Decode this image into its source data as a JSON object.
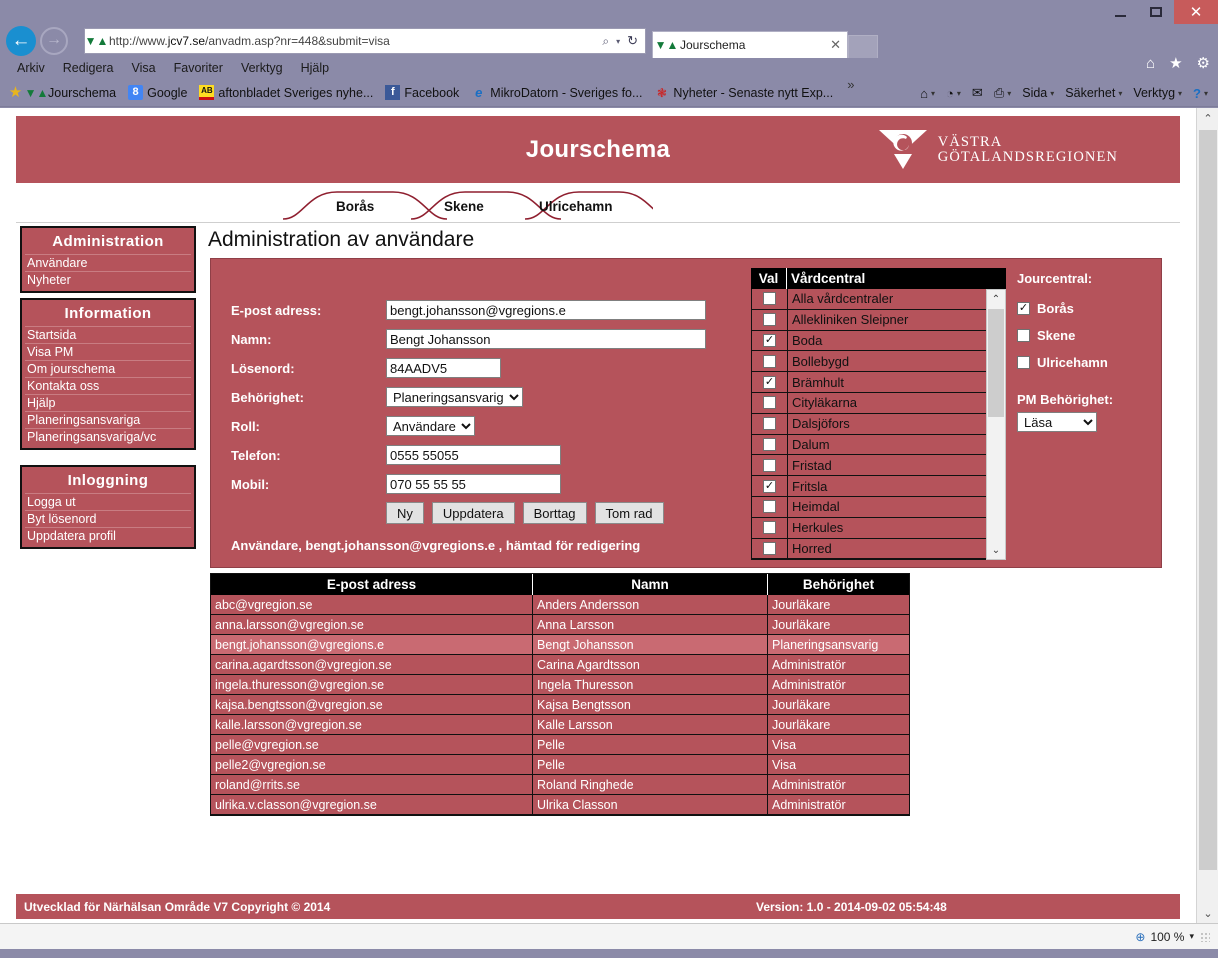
{
  "browser": {
    "window_controls": {
      "minimize": "—",
      "maximize": "▢",
      "close": "✕"
    },
    "back_icon": "←",
    "forward_icon": "→",
    "address": {
      "url_prefix": "http://www.",
      "url_domain": "jcv7.se",
      "url_suffix": "/anvadm.asp?nr=448&submit=visa",
      "search_icon": "⌕",
      "caret_icon": "▾",
      "refresh_icon": "↻"
    },
    "tab": {
      "title": "Jourschema",
      "close": "✕"
    },
    "ie_buttons": {
      "home": "⌂",
      "favorites": "★",
      "tools": "⚙"
    },
    "menu": [
      "Arkiv",
      "Redigera",
      "Visa",
      "Favoriter",
      "Verktyg",
      "Hjälp"
    ],
    "favorites": [
      {
        "label": "Jourschema",
        "icon": "jourschema-icon"
      },
      {
        "label": "Google",
        "icon": "google-icon",
        "glyph": "8"
      },
      {
        "label": "aftonbladet Sveriges nyhe...",
        "icon": "aftonbladet-icon",
        "glyph": "AB"
      },
      {
        "label": "Facebook",
        "icon": "facebook-icon",
        "glyph": "f"
      },
      {
        "label": "MikroDatorn - Sveriges fo...",
        "icon": "ie-icon",
        "glyph": "e"
      },
      {
        "label": "Nyheter - Senaste nytt Exp...",
        "icon": "expressen-icon"
      }
    ],
    "favorites_overflow": "»",
    "command_bar": [
      {
        "label": "",
        "icon": "home-icon",
        "glyph": "⌂",
        "caret": "▾"
      },
      {
        "label": "",
        "icon": "feeds-icon",
        "glyph": "◔",
        "caret": "▾"
      },
      {
        "label": "",
        "icon": "mail-icon",
        "glyph": "✉",
        "caret": ""
      },
      {
        "label": "",
        "icon": "print-icon",
        "glyph": "⎙",
        "caret": "▾"
      },
      {
        "label": "Sida",
        "icon": "page-menu",
        "glyph": "",
        "caret": "▾"
      },
      {
        "label": "Säkerhet",
        "icon": "security-menu",
        "glyph": "",
        "caret": "▾"
      },
      {
        "label": "Verktyg",
        "icon": "tools-menu",
        "glyph": "",
        "caret": "▾"
      },
      {
        "label": "",
        "icon": "help-icon",
        "glyph": "?",
        "caret": "▾"
      }
    ],
    "status": {
      "zoom": "100 %",
      "zoom_caret": "▾",
      "zoom_icon": "search-plus-icon"
    }
  },
  "site": {
    "banner_title": "Jourschema",
    "logo": {
      "line1": "VÄSTRA",
      "line2": "GÖTALANDSREGIONEN"
    },
    "tabs": [
      {
        "label": "Borås"
      },
      {
        "label": "Skene"
      },
      {
        "label": "Ulricehamn"
      }
    ],
    "heading": "Administration av användare",
    "footer": {
      "left": "Utvecklad för Närhälsan Område V7 Copyright © 2014",
      "right": "Version: 1.0 - 2014-09-02 05:54:48"
    },
    "accent_color": "#b5535b"
  },
  "sidebar": {
    "groups": [
      {
        "title": "Administration",
        "items": [
          "Användare",
          "Nyheter"
        ]
      },
      {
        "title": "Information",
        "items": [
          "Startsida",
          "Visa PM",
          "Om jourschema",
          "Kontakta oss",
          "Hjälp",
          "Planeringsansvariga",
          "Planeringsansvariga/vc"
        ]
      },
      {
        "title": "Inloggning",
        "items": [
          "Logga ut",
          "Byt lösenord",
          "Uppdatera profil"
        ]
      }
    ]
  },
  "form": {
    "fields": [
      {
        "label": "E-post adress:",
        "value": "bengt.johansson@vgregions.e",
        "type": "text",
        "width": "wide"
      },
      {
        "label": "Namn:",
        "value": "Bengt Johansson",
        "type": "text",
        "width": "wide"
      },
      {
        "label": "Lösenord:",
        "value": "84AADV5",
        "type": "text",
        "width": "mid"
      },
      {
        "label": "Behörighet:",
        "value": "Planeringsansvarig",
        "type": "select"
      },
      {
        "label": "Roll:",
        "value": "Användare",
        "type": "select"
      },
      {
        "label": "Telefon:",
        "value": "0555 55055",
        "type": "text",
        "width": "tel"
      },
      {
        "label": "Mobil:",
        "value": "070 55 55 55",
        "type": "text",
        "width": "tel"
      }
    ],
    "buttons": [
      "Ny",
      "Uppdatera",
      "Borttag",
      "Tom rad"
    ],
    "status_message": "Användare, bengt.johansson@vgregions.e , hämtad för redigering"
  },
  "vardcentral": {
    "headers": [
      "Val",
      "Vårdcentral"
    ],
    "rows": [
      {
        "name": "Alla vårdcentraler",
        "checked": false
      },
      {
        "name": "Allekliniken Sleipner",
        "checked": false
      },
      {
        "name": "Boda",
        "checked": true
      },
      {
        "name": "Bollebygd",
        "checked": false
      },
      {
        "name": "Brämhult",
        "checked": true
      },
      {
        "name": "Cityläkarna",
        "checked": false
      },
      {
        "name": "Dalsjöfors",
        "checked": false
      },
      {
        "name": "Dalum",
        "checked": false
      },
      {
        "name": "Fristad",
        "checked": false
      },
      {
        "name": "Fritsla",
        "checked": true
      },
      {
        "name": "Heimdal",
        "checked": false
      },
      {
        "name": "Herkules",
        "checked": false
      },
      {
        "name": "Horred",
        "checked": false
      }
    ],
    "scroll_up": "⌃",
    "scroll_down": "⌄"
  },
  "jourcentral": {
    "title": "Jourcentral:",
    "options": [
      {
        "label": "Borås",
        "checked": true
      },
      {
        "label": "Skene",
        "checked": false
      },
      {
        "label": "Ulricehamn",
        "checked": false
      }
    ],
    "pm_label": "PM Behörighet:",
    "pm_value": "Läsa"
  },
  "users_table": {
    "headers": [
      "E-post adress",
      "Namn",
      "Behörighet"
    ],
    "rows": [
      {
        "email": "abc@vgregion.se",
        "name": "Anders Andersson",
        "role": "Jourläkare",
        "selected": false
      },
      {
        "email": "anna.larsson@vgregion.se",
        "name": "Anna Larsson",
        "role": "Jourläkare",
        "selected": false
      },
      {
        "email": "bengt.johansson@vgregions.e",
        "name": "Bengt Johansson",
        "role": "Planeringsansvarig",
        "selected": true
      },
      {
        "email": "carina.agardtsson@vgregion.se",
        "name": "Carina Agardtsson",
        "role": "Administratör",
        "selected": false
      },
      {
        "email": "ingela.thuresson@vgregion.se",
        "name": "Ingela Thuresson",
        "role": "Administratör",
        "selected": false
      },
      {
        "email": "kajsa.bengtsson@vgregion.se",
        "name": "Kajsa Bengtsson",
        "role": "Jourläkare",
        "selected": false
      },
      {
        "email": "kalle.larsson@vgregion.se",
        "name": "Kalle Larsson",
        "role": "Jourläkare",
        "selected": false
      },
      {
        "email": "pelle@vgregion.se",
        "name": "Pelle",
        "role": "Visa",
        "selected": false
      },
      {
        "email": "pelle2@vgregion.se",
        "name": "Pelle",
        "role": "Visa",
        "selected": false
      },
      {
        "email": "roland@rrits.se",
        "name": "Roland Ringhede",
        "role": "Administratör",
        "selected": false
      },
      {
        "email": "ulrika.v.classon@vgregion.se",
        "name": "Ulrika Classon",
        "role": "Administratör",
        "selected": false
      }
    ]
  }
}
